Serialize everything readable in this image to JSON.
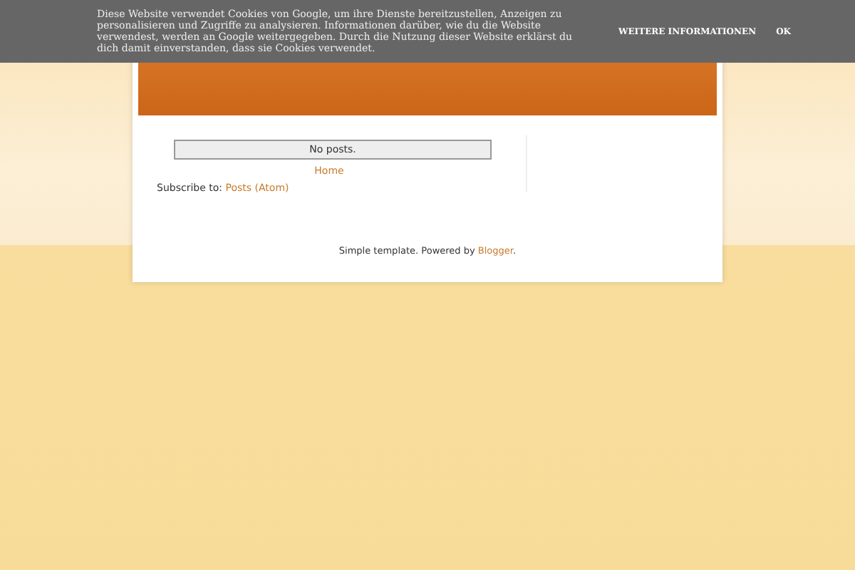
{
  "cookie_bar": {
    "message": "Diese Website verwendet Cookies von Google, um ihre Dienste bereitzustellen, Anzeigen zu personalisieren und Zugriffe zu analysieren. Informationen darüber, wie du die Website verwendest, werden an Google weitergegeben. Durch die Nutzung dieser Website erklärst du dich damit einverstanden, dass sie Cookies verwendet.",
    "buttons": [
      "WEITERE INFORMATIONEN",
      "OK"
    ]
  },
  "main": {
    "no_posts": "No posts.",
    "home_link": "Home",
    "subscribe_label": "Subscribe to:",
    "subscribe_link": "Posts (Atom)"
  },
  "footer": {
    "text": "Simple template. Powered by ",
    "link": "Blogger",
    "end": "."
  }
}
